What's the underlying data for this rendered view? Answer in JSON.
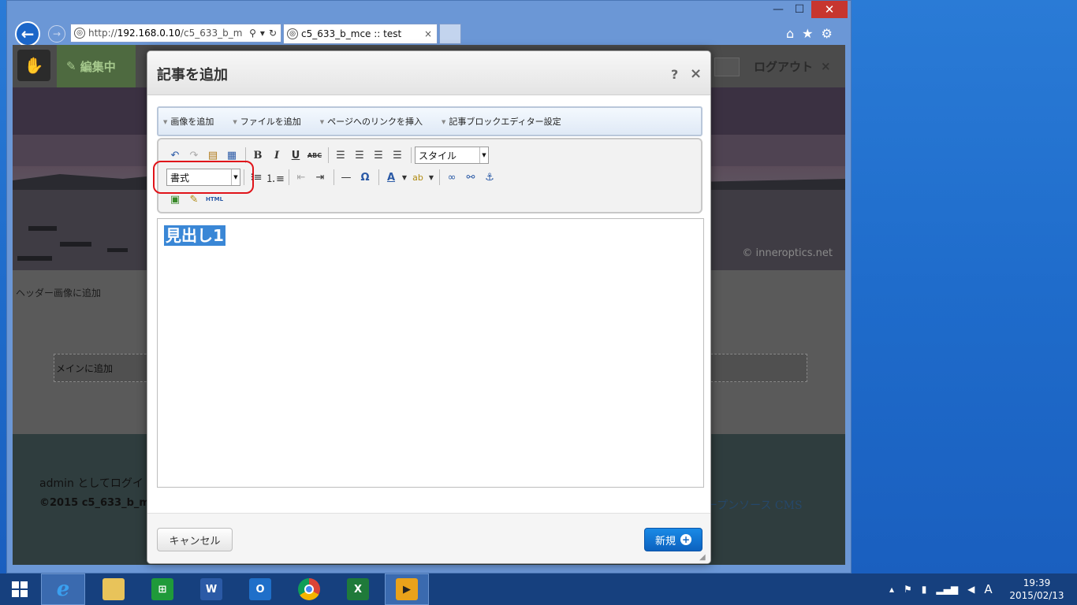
{
  "browser": {
    "url_prefix": "http://",
    "url_host": "192.168.0.10",
    "url_path": "/c5_633_b_m",
    "tab_title": "c5_633_b_mce :: test",
    "tab_close": "×"
  },
  "cms": {
    "edit_mode": "編集中",
    "logout": "ログアウト",
    "logout_close": "×",
    "header_image_credit": "© inneroptics.net",
    "header_area": "ヘッダー画像に追加",
    "main_area": "メインに追加",
    "footer_login": "admin としてログイ",
    "footer_copy": "©2015 c5_633_b_m",
    "footer_powered": "ープンソース CMS"
  },
  "dialog": {
    "title": "記事を追加",
    "help": "?",
    "close": "×",
    "insert_menu": [
      "画像を追加",
      "ファイルを追加",
      "ページへのリンクを挿入",
      "記事ブロックエディター設定"
    ],
    "toolbar": {
      "style_select": "スタイル",
      "format_select": "書式",
      "html_label": "HTML"
    },
    "editor_content": "見出し1",
    "cancel": "キャンセル",
    "submit": "新規"
  },
  "taskbar": {
    "ime": "A",
    "time": "19:39",
    "date": "2015/02/13"
  },
  "colors": {
    "highlight_ring": "#e0141a",
    "selection": "#3a87d6",
    "primary_button": "#0c62bf"
  }
}
